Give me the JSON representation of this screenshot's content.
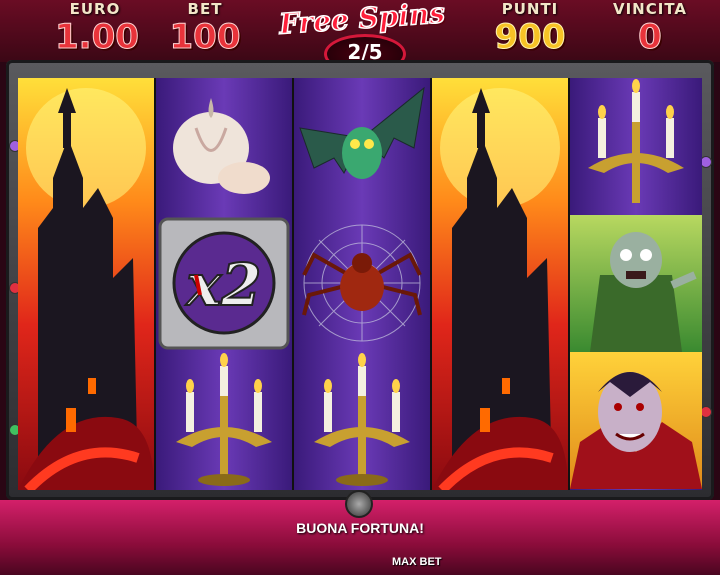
{
  "hud": {
    "euro": {
      "label": "EURO",
      "value": "1.00"
    },
    "bet": {
      "label": "BET",
      "value": "100"
    },
    "free_spins": {
      "title": "Free Spins",
      "progress": "2/5"
    },
    "punti": {
      "label": "PUNTI",
      "value": "900"
    },
    "vincita": {
      "label": "VINCITA",
      "value": "0"
    }
  },
  "reels": [
    {
      "symbols": [
        "castle"
      ]
    },
    {
      "symbols": [
        "garlic",
        "x2-wild",
        "candelabra"
      ]
    },
    {
      "symbols": [
        "bat",
        "spider",
        "candelabra"
      ]
    },
    {
      "symbols": [
        "castle"
      ]
    },
    {
      "symbols": [
        "candelabra",
        "zombie",
        "vampire"
      ]
    }
  ],
  "footer": {
    "message": "BUONA FORTUNA!",
    "max_bet_label": "MAX BET"
  },
  "colors": {
    "accent_red": "#e8333a",
    "accent_gold": "#f7c325",
    "reel_purple": "#6a3ab6"
  }
}
